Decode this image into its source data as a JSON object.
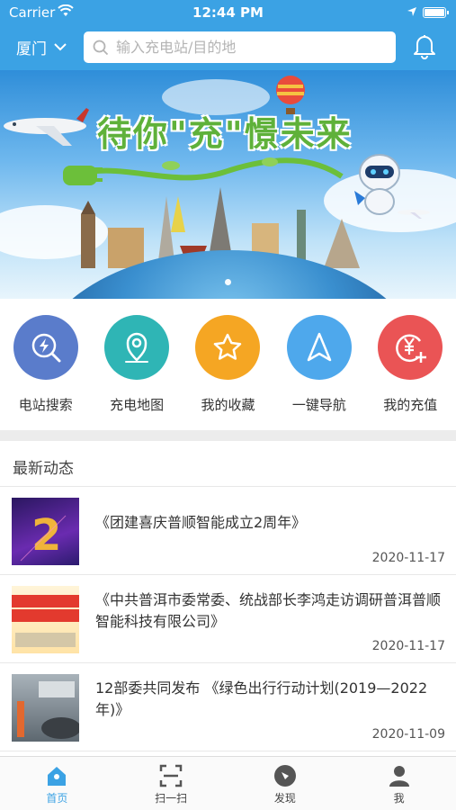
{
  "status_bar": {
    "carrier": "Carrier",
    "time": "12:44 PM"
  },
  "header": {
    "city": "厦门",
    "search_placeholder": "输入充电站/目的地",
    "icons": [
      "search-icon",
      "bell-icon",
      "chevron-down-icon"
    ]
  },
  "banner": {
    "title": "待你\"充\"憬未来",
    "slide_count": 1,
    "active_slide": 1
  },
  "quick_actions": [
    {
      "label": "电站搜索",
      "icon": "lightning-search-icon",
      "color": "#5a7ccb"
    },
    {
      "label": "充电地图",
      "icon": "map-pin-icon",
      "color": "#2fb5b5"
    },
    {
      "label": "我的收藏",
      "icon": "star-icon",
      "color": "#f5a623"
    },
    {
      "label": "一键导航",
      "icon": "navigation-arrow-icon",
      "color": "#4ea8ec"
    },
    {
      "label": "我的充值",
      "icon": "yuan-plus-icon",
      "color": "#ea5455"
    }
  ],
  "news": {
    "section_title": "最新动态",
    "items": [
      {
        "title": "《团建喜庆普顺智能成立2周年》",
        "date": "2020-11-17"
      },
      {
        "title": "《中共普洱市委常委、统战部长李鸿走访调研普洱普顺智能科技有限公司》",
        "date": "2020-11-17"
      },
      {
        "title": "12部委共同发布 《绿色出行行动计划(2019—2022年)》",
        "date": "2020-11-09"
      }
    ]
  },
  "tab_bar": {
    "items": [
      {
        "label": "首页",
        "icon": "home-icon",
        "active": true
      },
      {
        "label": "扫一扫",
        "icon": "scan-icon",
        "active": false
      },
      {
        "label": "发现",
        "icon": "compass-icon",
        "active": false
      },
      {
        "label": "我",
        "icon": "user-icon",
        "active": false
      }
    ]
  },
  "colors": {
    "primary": "#3ba2e4",
    "divider": "#ececec"
  }
}
